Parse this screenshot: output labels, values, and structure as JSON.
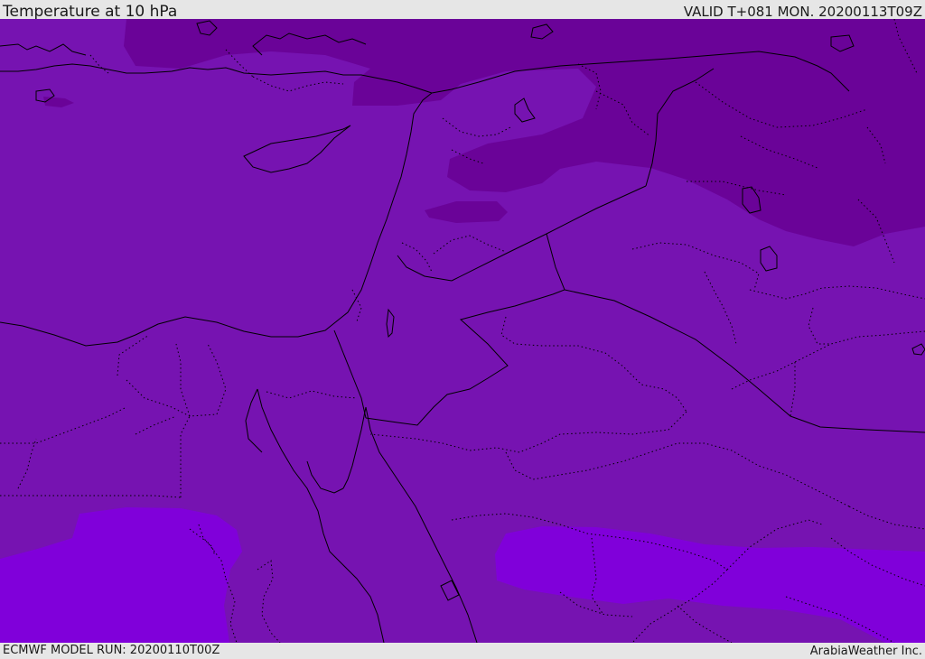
{
  "header": {
    "title": "Temperature at 10 hPa",
    "valid_time": "VALID T+081 MON. 20200113T09Z"
  },
  "footer": {
    "model_run": "ECMWF MODEL RUN: 20200110T00Z",
    "credit": "ArabiaWeather Inc."
  },
  "map": {
    "field": "temperature",
    "level": "10 hPa",
    "colors": {
      "base_purple": "#7613B1",
      "cold_purple": "#6A0398",
      "warm_violet": "#8000DA",
      "coastline": "#000000",
      "border": "#000000"
    }
  }
}
